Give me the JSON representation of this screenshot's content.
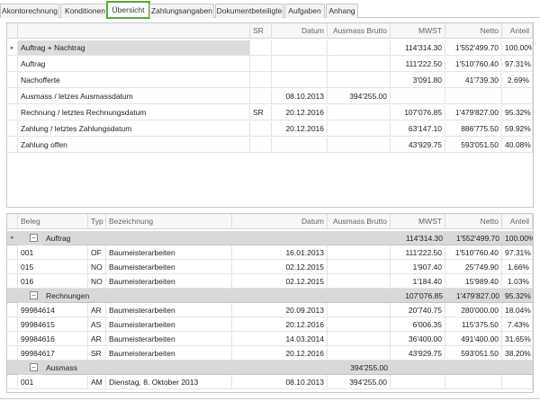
{
  "tabs": [
    {
      "label": "Akontorechnung"
    },
    {
      "label": "Konditionen"
    },
    {
      "label": "Übersicht",
      "active": true
    },
    {
      "label": "Zahlungsangaben"
    },
    {
      "label": "Dokumentbeteiligte"
    },
    {
      "label": "Aufgaben"
    },
    {
      "label": "Anhang"
    }
  ],
  "summary": {
    "headers": {
      "sr": "SR",
      "datum": "Datum",
      "ausmass": "Ausmass Brutto",
      "mwst": "MWST",
      "netto": "Netto",
      "anteil": "Anteil"
    },
    "rows": [
      {
        "label": "Auftrag + Nachtrag",
        "sr": "",
        "datum": "",
        "ausmass": "",
        "mwst": "114'314.30",
        "netto": "1'552'499.70",
        "anteil": "100.00%"
      },
      {
        "label": "Auftrag",
        "sr": "",
        "datum": "",
        "ausmass": "",
        "mwst": "111'222.50",
        "netto": "1'510'760.40",
        "anteil": "97.31%"
      },
      {
        "label": "Nachofferte",
        "sr": "",
        "datum": "",
        "ausmass": "",
        "mwst": "3'091.80",
        "netto": "41'739.30",
        "anteil": "2.69%"
      },
      {
        "label": "Ausmass / letzes Ausmassdatum",
        "sr": "",
        "datum": "08.10.2013",
        "ausmass": "394'255.00",
        "mwst": "",
        "netto": "",
        "anteil": ""
      },
      {
        "label": "Rechnung / letztes Rechnungsdatum",
        "sr": "SR",
        "datum": "20.12.2016",
        "ausmass": "",
        "mwst": "107'076.85",
        "netto": "1'479'827.00",
        "anteil": "95.32%"
      },
      {
        "label": "Zahlung / letztes Zahlungsdatum",
        "sr": "",
        "datum": "20.12.2016",
        "ausmass": "",
        "mwst": "63'147.10",
        "netto": "886'775.50",
        "anteil": "59.92%"
      },
      {
        "label": "Zahlung offen",
        "sr": "",
        "datum": "",
        "ausmass": "",
        "mwst": "43'929.75",
        "netto": "593'051.50",
        "anteil": "40.08%"
      }
    ]
  },
  "detail": {
    "headers": {
      "beleg": "Beleg",
      "typ": "Typ",
      "bezeichnung": "Bezeichnung",
      "datum": "Datum",
      "ausmass": "Ausmass Brutto",
      "mwst": "MWST",
      "netto": "Netto",
      "anteil": "Anteil"
    },
    "rows": [
      {
        "kind": "group",
        "label": "Auftrag",
        "ausmass": "",
        "mwst": "114'314.30",
        "netto": "1'552'499.70",
        "anteil": "100.00%",
        "current": true
      },
      {
        "kind": "data",
        "beleg": "001",
        "typ": "OF",
        "bezeichnung": "Baumeisterarbeiten",
        "datum": "16.01.2013",
        "ausmass": "",
        "mwst": "111'222.50",
        "netto": "1'510'760.40",
        "anteil": "97.31%"
      },
      {
        "kind": "data",
        "beleg": "015",
        "typ": "NO",
        "bezeichnung": "Baumeisterarbeiten",
        "datum": "02.12.2015",
        "ausmass": "",
        "mwst": "1'907.40",
        "netto": "25'749.90",
        "anteil": "1.66%"
      },
      {
        "kind": "data",
        "beleg": "016",
        "typ": "NO",
        "bezeichnung": "Baumeisterarbeiten",
        "datum": "02.12.2015",
        "ausmass": "",
        "mwst": "1'184.40",
        "netto": "15'989.40",
        "anteil": "1.03%"
      },
      {
        "kind": "group",
        "label": "Rechnungen",
        "ausmass": "",
        "mwst": "107'076.85",
        "netto": "1'479'827.00",
        "anteil": "95.32%"
      },
      {
        "kind": "data",
        "beleg": "99984614",
        "typ": "AR",
        "bezeichnung": "Baumeisterarbeiten",
        "datum": "20.09.2013",
        "ausmass": "",
        "mwst": "20'740.75",
        "netto": "280'000.00",
        "anteil": "18.04%"
      },
      {
        "kind": "data",
        "beleg": "99984615",
        "typ": "AS",
        "bezeichnung": "Baumeisterarbeiten",
        "datum": "20.12.2016",
        "ausmass": "",
        "mwst": "6'006.35",
        "netto": "115'375.50",
        "anteil": "7.43%"
      },
      {
        "kind": "data",
        "beleg": "99984616",
        "typ": "AR",
        "bezeichnung": "Baumeisterarbeiten",
        "datum": "14.03.2014",
        "ausmass": "",
        "mwst": "36'400.00",
        "netto": "491'400.00",
        "anteil": "31.65%"
      },
      {
        "kind": "data",
        "beleg": "99984617",
        "typ": "SR",
        "bezeichnung": "Baumeisterarbeiten",
        "datum": "20.12.2016",
        "ausmass": "",
        "mwst": "43'929.75",
        "netto": "593'051.50",
        "anteil": "38.20%"
      },
      {
        "kind": "group",
        "label": "Ausmass",
        "ausmass": "394'255.00",
        "mwst": "",
        "netto": "",
        "anteil": ""
      },
      {
        "kind": "data",
        "beleg": "001",
        "typ": "AM",
        "bezeichnung": "Dienstag, 8. Oktober 2013",
        "datum": "08.10.2013",
        "ausmass": "394'255.00",
        "mwst": "",
        "netto": "",
        "anteil": ""
      }
    ]
  },
  "icons": {
    "current_row": "row-indicator-icon",
    "collapse": "collapse-icon"
  },
  "colors": {
    "active_tab_border": "#5aa73a",
    "group_row": "#d9d9d9",
    "selected_row": "#dcdcdc"
  }
}
